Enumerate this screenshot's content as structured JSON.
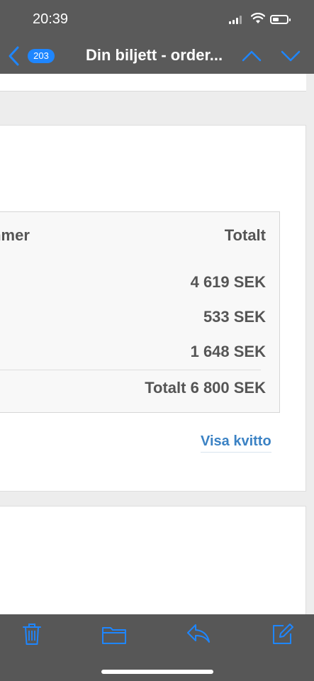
{
  "status_bar": {
    "time": "20:39"
  },
  "nav": {
    "unread_count": "203",
    "title": "Din biljett - order..."
  },
  "order_table": {
    "header_left": "mmer",
    "header_right": "Totalt",
    "rows": [
      "4 619 SEK",
      "533 SEK",
      "1 648 SEK"
    ],
    "total": "Totalt 6 800 SEK"
  },
  "receipt_link": "Visa kvitto",
  "colors": {
    "accent": "#1e86ff",
    "link": "#3b82c4",
    "bars": "#5a5a5a"
  },
  "toolbar": {
    "icons": [
      "trash-icon",
      "folder-icon",
      "reply-icon",
      "compose-icon"
    ]
  }
}
